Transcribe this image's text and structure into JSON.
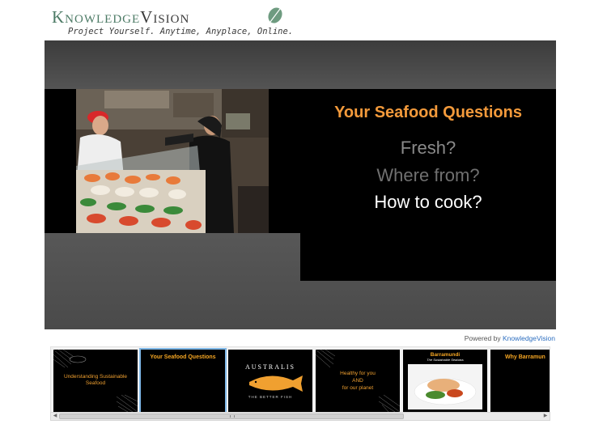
{
  "logo": {
    "word1": "Knowledge",
    "word2": "Vision",
    "tagline": "Project Yourself. Anytime, Anyplace, Online."
  },
  "slide": {
    "title": "Your Seafood Questions",
    "questions": [
      "Fresh?",
      "Where from?",
      "How to cook?"
    ]
  },
  "powered": {
    "prefix": "Powered by ",
    "link": "KnowledgeVision"
  },
  "thumbnails": [
    {
      "text": "Understanding Sustainable Seafood"
    },
    {
      "title": "Your Seafood Questions"
    },
    {
      "brand": "AUSTRALIS",
      "tagline": "THE BETTER FISH"
    },
    {
      "line1": "Healthy for you",
      "line2": "AND",
      "line3": "for our planet"
    },
    {
      "title": "Barramundi",
      "subtitle": "The Sustainable Seabass"
    },
    {
      "title": "Why Barramun"
    }
  ],
  "colors": {
    "accent": "#f39a3b",
    "brand_green": "#4d7b66",
    "link": "#2e6fc0"
  }
}
